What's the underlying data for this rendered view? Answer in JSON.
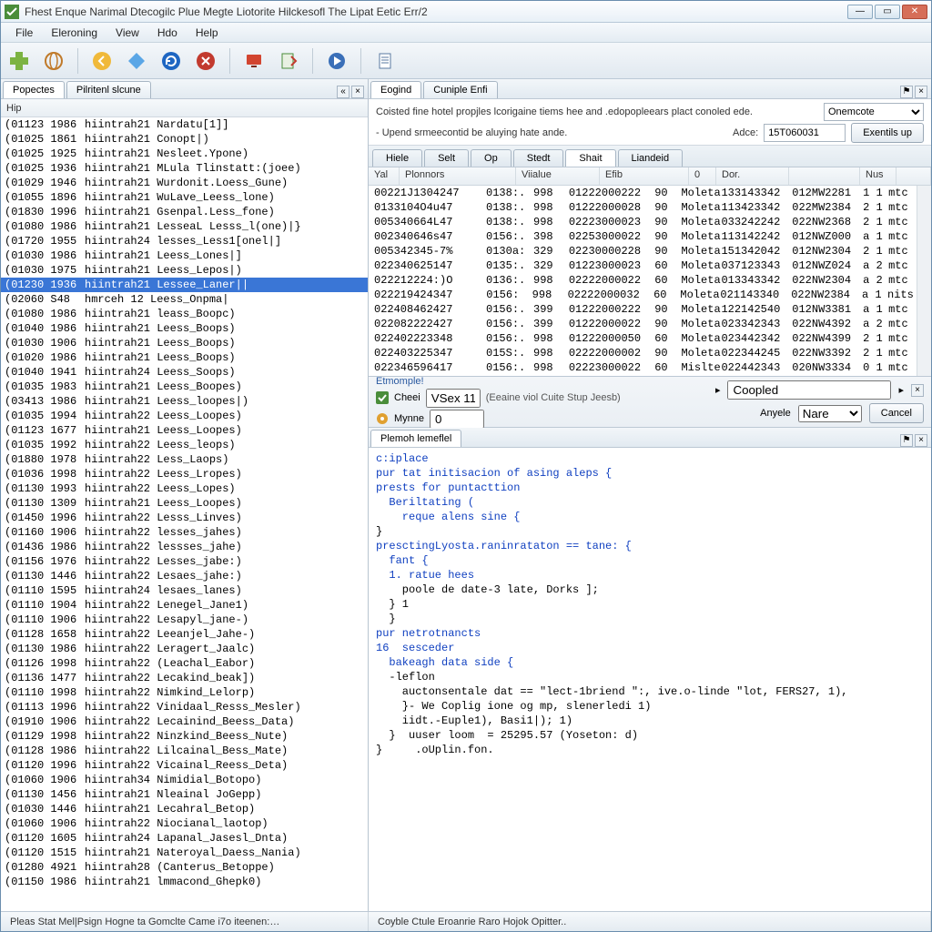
{
  "window": {
    "title": "Fhest Enque Narimal Dtecogilc Plue Megte Liotorite Hilckesofl The Lipat Eetic Err/2"
  },
  "menu": [
    "File",
    "Eleroning",
    "View",
    "Hdo",
    "Help"
  ],
  "left": {
    "tabs": [
      {
        "label": "Popectes",
        "active": true
      },
      {
        "label": "Pilritenl slcune",
        "active": false
      }
    ],
    "columnHeader": "Hip",
    "selectedIndex": 11,
    "rows": [
      {
        "c1": "(01123 1986",
        "c2": "hiintrah21 Nardatu[1]]"
      },
      {
        "c1": "(01025 1861",
        "c2": "hiintrah21 Conopt|)"
      },
      {
        "c1": "(01025 1925",
        "c2": "hiintrah21 Nesleet.Ypone)"
      },
      {
        "c1": "(01025 1936",
        "c2": "hiintrah21 MLula Tlinstatt:(joee)"
      },
      {
        "c1": "(01029 1946",
        "c2": "hiintrah21 Wurdonit.Loess_Gune)"
      },
      {
        "c1": "(01055 1896",
        "c2": "hiintrah21 WuLave_Leess_lone)"
      },
      {
        "c1": "(01830 1996",
        "c2": "hiintrah21 Gsenpal.Less_fone)"
      },
      {
        "c1": "(01080 1986",
        "c2": "hiintrah21 LesseaL Lesss_l(one)|}"
      },
      {
        "c1": "(01720 1955",
        "c2": "hiintrah24 lesses_Less1[onel|]"
      },
      {
        "c1": "(01030 1986",
        "c2": "hiintrah21 Leess_Lones|]"
      },
      {
        "c1": "(01030 1975",
        "c2": "hiintrah21 Leess_Lepos|)"
      },
      {
        "c1": "(01230 1936",
        "c2": "hiintrah21 Lessee_Laner||"
      },
      {
        "c1": "(02060 S48",
        "c2": "hmrceh 12 Leess_Onpma|"
      },
      {
        "c1": "(01080 1986",
        "c2": "hiintrah21 leass_Boopc)"
      },
      {
        "c1": "(01040 1986",
        "c2": "hiintrah21 Leess_Boops)"
      },
      {
        "c1": "(01030 1906",
        "c2": "hiintrah21 Leess_Boops)"
      },
      {
        "c1": "(01020 1986",
        "c2": "hiintrah21 Leess_Boops)"
      },
      {
        "c1": "(01040 1941",
        "c2": "hiintrah24 Leess_Soops)"
      },
      {
        "c1": "(01035 1983",
        "c2": "hiintrah21 Leess_Boopes)"
      },
      {
        "c1": "(03413 1986",
        "c2": "hiintrah21 Leess_loopes|)"
      },
      {
        "c1": "(01035 1994",
        "c2": "hiintrah22 Leess_Loopes)"
      },
      {
        "c1": "(01123 1677",
        "c2": "hiintrah21 Leess_Loopes)"
      },
      {
        "c1": "(01035 1992",
        "c2": "hiintrah22 Leess_leops)"
      },
      {
        "c1": "(01880 1978",
        "c2": "hiintrah22 Less_Laops)"
      },
      {
        "c1": "(01036 1998",
        "c2": "hiintrah22 Leess_Lropes)"
      },
      {
        "c1": "(01130 1993",
        "c2": "hiintrah22 Leess_Lopes)"
      },
      {
        "c1": "(01130 1309",
        "c2": "hiintrah21 Leess_Loopes)"
      },
      {
        "c1": "(01450 1996",
        "c2": "hiintrah22 Lesss_Linves)"
      },
      {
        "c1": "(01160 1906",
        "c2": "hiintrah22 lesses_jahes)"
      },
      {
        "c1": "(01436 1986",
        "c2": "hiintrah22 lessses_jahe)"
      },
      {
        "c1": "(01156 1976",
        "c2": "hiintrah22 Lesses_jabe:)"
      },
      {
        "c1": "(01130 1446",
        "c2": "hiintrah22 Lesaes_jahe:)"
      },
      {
        "c1": "(01110 1595",
        "c2": "hiintrah24 lesaes_lanes)"
      },
      {
        "c1": "(01110 1904",
        "c2": "hiintrah22 Lenegel_Jane1)"
      },
      {
        "c1": "(01110 1906",
        "c2": "hiintrah22 Lesapyl_jane-)"
      },
      {
        "c1": "(01128 1658",
        "c2": "hiintrah22 Leeanjel_Jahe-)"
      },
      {
        "c1": "(01130 1986",
        "c2": "hiintrah22 Leragert_Jaalc)"
      },
      {
        "c1": "(01126 1998",
        "c2": "hiintrah22 (Leachal_Eabor)"
      },
      {
        "c1": "(01136 1477",
        "c2": "hiintrah22 Lecakind_beak])"
      },
      {
        "c1": "(01110 1998",
        "c2": "hiintrah22 Nimkind_Lelorp)"
      },
      {
        "c1": "(01113 1996",
        "c2": "hiintrah22 Vinidaal_Resss_Mesler)"
      },
      {
        "c1": "(01910 1906",
        "c2": "hiintrah22 Lecainind_Beess_Data)"
      },
      {
        "c1": "(01129 1998",
        "c2": "hiintrah22 Ninzkind_Beess_Nute)"
      },
      {
        "c1": "(01128 1986",
        "c2": "hiintrah22 Lilcainal_Bess_Mate)"
      },
      {
        "c1": "(01120 1996",
        "c2": "hiintrah22 Vicainal_Reess_Deta)"
      },
      {
        "c1": "(01060 1906",
        "c2": "hiintrah34 Nimidial_Botopo)"
      },
      {
        "c1": "(01130 1456",
        "c2": "hiintrah21 Nleainal JoGepp)"
      },
      {
        "c1": "(01030 1446",
        "c2": "hiintrah21 Lecahral_Betop)"
      },
      {
        "c1": "(01060 1906",
        "c2": "hiintrah22 Niocianal_laotop)"
      },
      {
        "c1": "(01120 1605",
        "c2": "hiintrah24 Lapanal_Jasesl_Dnta)"
      },
      {
        "c1": "(01120 1515",
        "c2": "hiintrah21 Nateroyal_Daess_Nania)"
      },
      {
        "c1": "(01280 4921",
        "c2": "hiintrah28 (Canterus_Betoppe)"
      },
      {
        "c1": "(01150 1986",
        "c2": "hiintrah21 lmmacond_Ghepk0)"
      }
    ]
  },
  "right": {
    "topTabs": [
      {
        "label": "Eogind",
        "active": true
      },
      {
        "label": "Cuniple Enfi",
        "active": false
      }
    ],
    "infoLine": "Coisted fine hotel propjles lcorigaine tiems hee and .edopopleears plact conoled ede.",
    "dropdown": "Onemcote",
    "line2": "- Upend srmeecontid be aluying hate ande.",
    "adce_label": "Adce:",
    "adce_value": "15T060031",
    "exentils": "Exentils up",
    "subtabs": [
      "Hiele",
      "Selt",
      "Op",
      "Stedt",
      "Shait",
      "Liandeid"
    ],
    "subtabActive": 4,
    "gridHead": [
      "Yal",
      "Plonnors",
      "",
      "Viialue",
      "",
      "Efib",
      "0",
      "Dor.",
      "",
      "Nus",
      ""
    ],
    "gridRows": [
      [
        "00221J1304247",
        "0138:.",
        "998",
        "01222000222",
        "90",
        "Moleta",
        "133143342",
        "012MW2281",
        "1 1",
        "mtc"
      ],
      [
        "0133104O4u47",
        "0138:.",
        "998",
        "01222000028",
        "90",
        "Moleta",
        "113423342",
        "022MW2384",
        "2 1",
        "mtc"
      ],
      [
        "005340664L47",
        "0138:.",
        "998",
        "02223000023",
        "90",
        "Moleta",
        "033242242",
        "022NW2368",
        "2 1",
        "mtc"
      ],
      [
        "002340646s47",
        "0156:.",
        "398",
        "02253000022",
        "90",
        "Moleta",
        "113142242",
        "012NWZ000",
        "a 1",
        "mtc"
      ],
      [
        "005342345-7%",
        "0130a:",
        "329",
        "02230000228",
        "90",
        "Moleta",
        "151342042",
        "012NW2304",
        "2 1",
        "mtc"
      ],
      [
        "022340625147",
        "0135:.",
        "329",
        "01223000023",
        "60",
        "Moleta",
        "037123343",
        "012NWZ024",
        "a 2",
        "mtc"
      ],
      [
        "022212224:)O",
        "0136:.",
        "998",
        "02222000022",
        "60",
        "Moleta",
        "013343342",
        "022NW2304",
        "a 2",
        "mtc"
      ],
      [
        "022219424347",
        "0156:",
        "998",
        "02222000032",
        "60",
        "Moleta",
        "021143340",
        "022NW2384",
        "a 1",
        "nits"
      ],
      [
        "022408462427",
        "0156:.",
        "399",
        "01222000222",
        "90",
        "Moleta",
        "122142540",
        "012NW3381",
        "a 1",
        "mtc"
      ],
      [
        "022082222427",
        "0156:.",
        "399",
        "01222000022",
        "90",
        "Moleta",
        "023342343",
        "022NW4392",
        "a 2",
        "mtc"
      ],
      [
        "022402223348",
        "0156:.",
        "998",
        "01222000050",
        "60",
        "Moleta",
        "023442342",
        "022NW4399",
        "2 1",
        "mtc"
      ],
      [
        "022403225347",
        "015S:.",
        "998",
        "02222000002",
        "90",
        "Moleta",
        "022344245",
        "022NW3392",
        "2 1",
        "mtc"
      ],
      [
        "022346596417",
        "0156:.",
        "998",
        "02223000022",
        "60",
        "Mislte",
        "022442343",
        "020NW3334",
        "0 1",
        "mtc"
      ]
    ],
    "mid": {
      "title": "Etmomple!",
      "check_label": "Cheei",
      "check_value": "VSex 11",
      "paren": "(Eeaine viol Cuite Stup Jeesb)",
      "pin": "▸",
      "coopled": "Coopled",
      "mynine_label": "Mynne",
      "mynine_value": "0",
      "anyele": "Anyele",
      "nare": "Nare",
      "cancel": "Cancel"
    },
    "codeTab": "Plemoh lemeflel",
    "code": [
      {
        "t": "c:iplace",
        "cls": "kw"
      },
      {
        "t": "pur tat initisacion of asing aleps {",
        "cls": "kw"
      },
      {
        "t": "prests for puntacttion",
        "cls": "kw"
      },
      {
        "t": "  Beriltating (",
        "cls": "kw"
      },
      {
        "t": "    reque alens sine {",
        "cls": "kw"
      },
      {
        "t": "}",
        "cls": ""
      },
      {
        "t": "presctingLyosta.raninrataton == tane: {",
        "cls": "kw"
      },
      {
        "t": "  fant {",
        "cls": "kw"
      },
      {
        "t": "  1. ratue hees",
        "cls": "kw"
      },
      {
        "t": "    poole de date-3 late, Dorks ];",
        "cls": ""
      },
      {
        "t": "  } 1",
        "cls": ""
      },
      {
        "t": "  }",
        "cls": ""
      },
      {
        "t": "pur netrotnancts",
        "cls": "kw"
      },
      {
        "t": "16  sesceder",
        "cls": "kw"
      },
      {
        "t": "  bakeagh data side {",
        "cls": "kw"
      },
      {
        "t": "  -leflon",
        "cls": ""
      },
      {
        "t": "    auctonsentale dat == \"lect-1briend \":, ive.o-linde \"lot, FERS27, 1),",
        "cls": ""
      },
      {
        "t": "    }- We Coplig ione og mp, slenerledi 1)",
        "cls": ""
      },
      {
        "t": "    iidt.-Euple1), Basi1|); 1)",
        "cls": ""
      },
      {
        "t": "  }  uuser loom  = 25295.57 (Yoseton: d)",
        "cls": ""
      },
      {
        "t": "}     .oUplin.fon.",
        "cls": ""
      }
    ]
  },
  "status": {
    "left": "Pleas Stat Mel|Psign Hogne ta Gomclte Came i7o iteenen:…",
    "right": "Coyble Ctule Eroanrie Raro Hojok Opitter.."
  },
  "icons": {
    "plus": "#7cb342",
    "globe": "#e08a30",
    "left": "#f0b93a",
    "diamond": "#2b7fd4",
    "refresh": "#1e66c2",
    "stop": "#c23a2e",
    "monitor": "#d24530",
    "doc": "#4a8d3a",
    "run": "#3a6fb8",
    "page": "#5a7aa0"
  }
}
